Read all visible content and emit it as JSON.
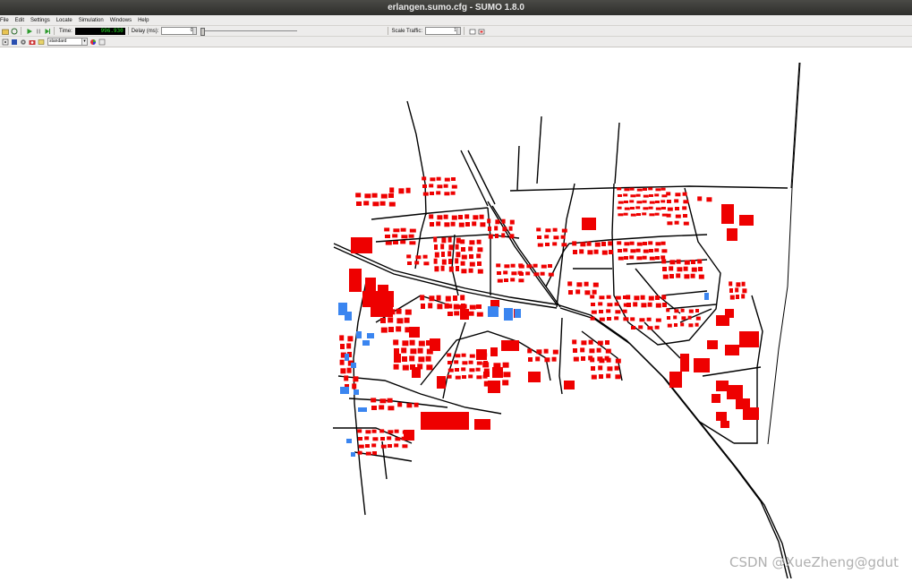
{
  "window": {
    "title": "erlangen.sumo.cfg - SUMO 1.8.0"
  },
  "menu": {
    "items": [
      "File",
      "Edit",
      "Settings",
      "Locate",
      "Simulation",
      "Windows",
      "Help"
    ]
  },
  "toolbar": {
    "time_label": "Time:",
    "time_value": "996.930",
    "delay_label": "Delay (ms):",
    "delay_value": "0",
    "scale_label": "Scale Traffic:",
    "scale_value": "1"
  },
  "view": {
    "scheme": "standard"
  },
  "colors": {
    "building": "#ee0000",
    "parking": "#3a85f0",
    "road": "#000000"
  },
  "watermark": "CSDN @XueZheng@gdut",
  "icons": [
    "open-icon",
    "reload-icon",
    "run-icon",
    "pause-icon",
    "step-icon",
    "camera-icon",
    "locate-icon",
    "gear-icon",
    "color-wheel-icon"
  ]
}
